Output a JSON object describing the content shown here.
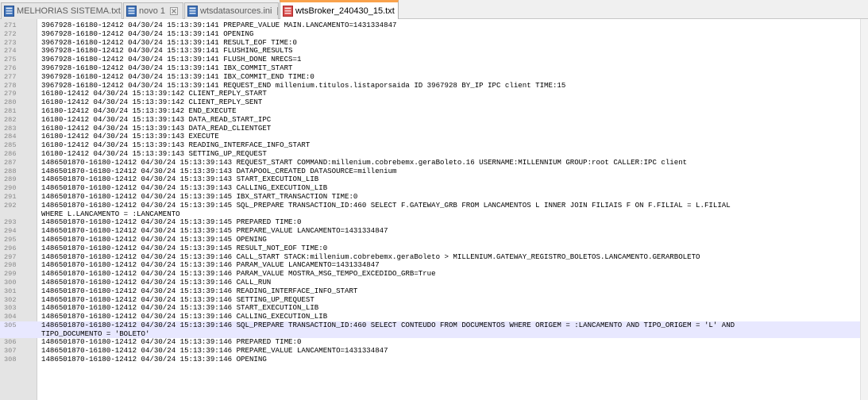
{
  "tabs": [
    {
      "label": "MELHORIAS SISTEMA.txt",
      "icon": "saved-file-icon",
      "active": false
    },
    {
      "label": "novo 1",
      "icon": "saved-file-icon",
      "active": false
    },
    {
      "label": "wtsdatasources.ini",
      "icon": "saved-file-icon",
      "active": false
    },
    {
      "label": "wtsBroker_240430_15.txt",
      "icon": "unsaved-file-icon",
      "active": true
    }
  ],
  "colors": {
    "active_tab_accent": "#f9a24c",
    "close_red": "#e04343",
    "file_icon_blue": "#3b6fb6",
    "file_icon_red": "#d94848",
    "current_line": "#e8e8ff"
  },
  "lines": [
    {
      "n": "271",
      "text": "3967928-16180-12412 04/30/24 15:13:39:141 PREPARE_VALUE MAIN.LANCAMENTO=1431334847"
    },
    {
      "n": "272",
      "text": "3967928-16180-12412 04/30/24 15:13:39:141 OPENING"
    },
    {
      "n": "273",
      "text": "3967928-16180-12412 04/30/24 15:13:39:141 RESULT_EOF TIME:0"
    },
    {
      "n": "274",
      "text": "3967928-16180-12412 04/30/24 15:13:39:141 FLUSHING_RESULTS"
    },
    {
      "n": "275",
      "text": "3967928-16180-12412 04/30/24 15:13:39:141 FLUSH_DONE NRECS=1"
    },
    {
      "n": "276",
      "text": "3967928-16180-12412 04/30/24 15:13:39:141 IBX_COMMIT_START"
    },
    {
      "n": "277",
      "text": "3967928-16180-12412 04/30/24 15:13:39:141 IBX_COMMIT_END TIME:0"
    },
    {
      "n": "278",
      "text": "3967928-16180-12412 04/30/24 15:13:39:141 REQUEST_END millenium.titulos.listaporsaida ID 3967928 BY_IP IPC client TIME:15"
    },
    {
      "n": "279",
      "text": "16180-12412 04/30/24 15:13:39:142 CLIENT_REPLY_START"
    },
    {
      "n": "280",
      "text": "16180-12412 04/30/24 15:13:39:142 CLIENT_REPLY_SENT"
    },
    {
      "n": "281",
      "text": "16180-12412 04/30/24 15:13:39:142 END_EXECUTE"
    },
    {
      "n": "282",
      "text": "16180-12412 04/30/24 15:13:39:143 DATA_READ_START_IPC"
    },
    {
      "n": "283",
      "text": "16180-12412 04/30/24 15:13:39:143 DATA_READ_CLIENTGET"
    },
    {
      "n": "284",
      "text": "16180-12412 04/30/24 15:13:39:143 EXECUTE"
    },
    {
      "n": "285",
      "text": "16180-12412 04/30/24 15:13:39:143 READING_INTERFACE_INFO_START"
    },
    {
      "n": "286",
      "text": "16180-12412 04/30/24 15:13:39:143 SETTING_UP_REQUEST"
    },
    {
      "n": "287",
      "text": "1486501870-16180-12412 04/30/24 15:13:39:143 REQUEST_START COMMAND:millenium.cobrebemx.geraBoleto.16 USERNAME:MILLENNIUM GROUP:root CALLER:IPC client"
    },
    {
      "n": "288",
      "text": "1486501870-16180-12412 04/30/24 15:13:39:143 DATAPOOL_CREATED DATASOURCE=millenium"
    },
    {
      "n": "289",
      "text": "1486501870-16180-12412 04/30/24 15:13:39:143 START_EXECUTION_LIB"
    },
    {
      "n": "290",
      "text": "1486501870-16180-12412 04/30/24 15:13:39:143 CALLING_EXECUTION_LIB"
    },
    {
      "n": "291",
      "text": "1486501870-16180-12412 04/30/24 15:13:39:145 IBX_START_TRANSACTION TIME:0"
    },
    {
      "n": "292",
      "text": "1486501870-16180-12412 04/30/24 15:13:39:145 SQL_PREPARE TRANSACTION_ID:460 SELECT F.GATEWAY_GRB FROM LANCAMENTOS L INNER JOIN FILIAIS F ON F.FILIAL = L.FILIAL"
    },
    {
      "n": "",
      "text": "WHERE L.LANCAMENTO = :LANCAMENTO"
    },
    {
      "n": "293",
      "text": "1486501870-16180-12412 04/30/24 15:13:39:145 PREPARED TIME:0"
    },
    {
      "n": "294",
      "text": "1486501870-16180-12412 04/30/24 15:13:39:145 PREPARE_VALUE LANCAMENTO=1431334847"
    },
    {
      "n": "295",
      "text": "1486501870-16180-12412 04/30/24 15:13:39:145 OPENING"
    },
    {
      "n": "296",
      "text": "1486501870-16180-12412 04/30/24 15:13:39:145 RESULT_NOT_EOF TIME:0"
    },
    {
      "n": "297",
      "text": "1486501870-16180-12412 04/30/24 15:13:39:146 CALL_START STACK:millenium.cobrebemx.geraBoleto > MILLENIUM.GATEWAY_REGISTRO_BOLETOS.LANCAMENTO.GERARBOLETO"
    },
    {
      "n": "298",
      "text": "1486501870-16180-12412 04/30/24 15:13:39:146 PARAM_VALUE LANCAMENTO=1431334847"
    },
    {
      "n": "299",
      "text": "1486501870-16180-12412 04/30/24 15:13:39:146 PARAM_VALUE MOSTRA_MSG_TEMPO_EXCEDIDO_GRB=True"
    },
    {
      "n": "300",
      "text": "1486501870-16180-12412 04/30/24 15:13:39:146 CALL_RUN"
    },
    {
      "n": "301",
      "text": "1486501870-16180-12412 04/30/24 15:13:39:146 READING_INTERFACE_INFO_START"
    },
    {
      "n": "302",
      "text": "1486501870-16180-12412 04/30/24 15:13:39:146 SETTING_UP_REQUEST"
    },
    {
      "n": "303",
      "text": "1486501870-16180-12412 04/30/24 15:13:39:146 START_EXECUTION_LIB"
    },
    {
      "n": "304",
      "text": "1486501870-16180-12412 04/30/24 15:13:39:146 CALLING_EXECUTION_LIB"
    },
    {
      "n": "305",
      "text": "1486501870-16180-12412 04/30/24 15:13:39:146 SQL_PREPARE TRANSACTION_ID:460 SELECT CONTEUDO FROM DOCUMENTOS WHERE ORIGEM = :LANCAMENTO AND TIPO_ORIGEM = 'L' AND",
      "current": true
    },
    {
      "n": "",
      "text": "TIPO_DOCUMENTO = 'BOLETO'",
      "current": true
    },
    {
      "n": "306",
      "text": "1486501870-16180-12412 04/30/24 15:13:39:146 PREPARED TIME:0"
    },
    {
      "n": "307",
      "text": "1486501870-16180-12412 04/30/24 15:13:39:146 PREPARE_VALUE LANCAMENTO=1431334847"
    },
    {
      "n": "308",
      "text": "1486501870-16180-12412 04/30/24 15:13:39:146 OPENING"
    }
  ]
}
